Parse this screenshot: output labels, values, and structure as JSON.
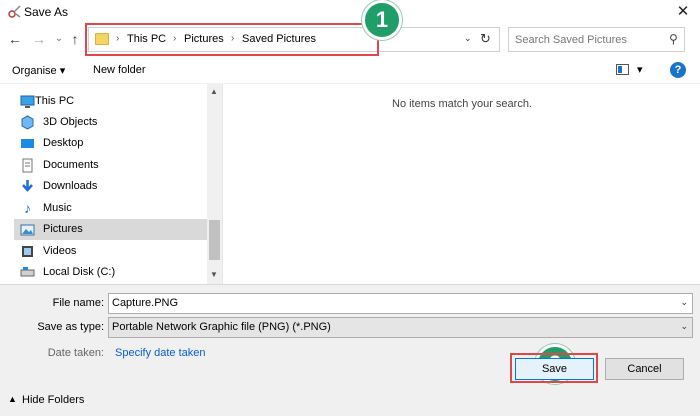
{
  "window": {
    "title": "Save As",
    "close_glyph": "✕"
  },
  "nav": {
    "back_glyph": "←",
    "forward_glyph": "→",
    "recent_glyph": "⌄",
    "up_glyph": "↑",
    "breadcrumbs": [
      "This PC",
      "Pictures",
      "Saved Pictures"
    ],
    "crumb_sep": "›",
    "dropdown_glyph": "⌄",
    "refresh_glyph": "↻"
  },
  "search": {
    "placeholder": "Search Saved Pictures",
    "icon_glyph": "⚲"
  },
  "annotations": {
    "badge1": "1",
    "badge2": "2"
  },
  "toolbar": {
    "organise": "Organise",
    "organise_arrow": "▾",
    "new_folder": "New folder",
    "view_arrow": "▾",
    "help": "?"
  },
  "sidebar": {
    "items": [
      {
        "label": "This PC",
        "icon": "pc-icon"
      },
      {
        "label": "3D Objects",
        "icon": "cube-icon"
      },
      {
        "label": "Desktop",
        "icon": "desktop-icon"
      },
      {
        "label": "Documents",
        "icon": "documents-icon"
      },
      {
        "label": "Downloads",
        "icon": "download-icon"
      },
      {
        "label": "Music",
        "icon": "music-icon"
      },
      {
        "label": "Pictures",
        "icon": "pictures-icon",
        "selected": true
      },
      {
        "label": "Videos",
        "icon": "videos-icon"
      },
      {
        "label": "Local Disk (C:)",
        "icon": "disk-icon"
      }
    ],
    "scroll_up": "▲",
    "scroll_down": "▼"
  },
  "main": {
    "empty_message": "No items match your search."
  },
  "form": {
    "file_name_label": "File name:",
    "file_name_value": "Capture.PNG",
    "save_type_label": "Save as type:",
    "save_type_value": "Portable Network Graphic file (PNG) (*.PNG)",
    "date_taken_label": "Date taken:",
    "date_taken_link": "Specify date taken",
    "dropdown_glyph": "⌄"
  },
  "footer": {
    "hide_folders": "Hide Folders",
    "hide_arrow": "▲",
    "save": "Save",
    "cancel": "Cancel"
  },
  "colors": {
    "highlight": "#e0474c",
    "badge": "#1f9e6a",
    "link": "#0b5bcf",
    "selection": "#d9d9d9"
  }
}
